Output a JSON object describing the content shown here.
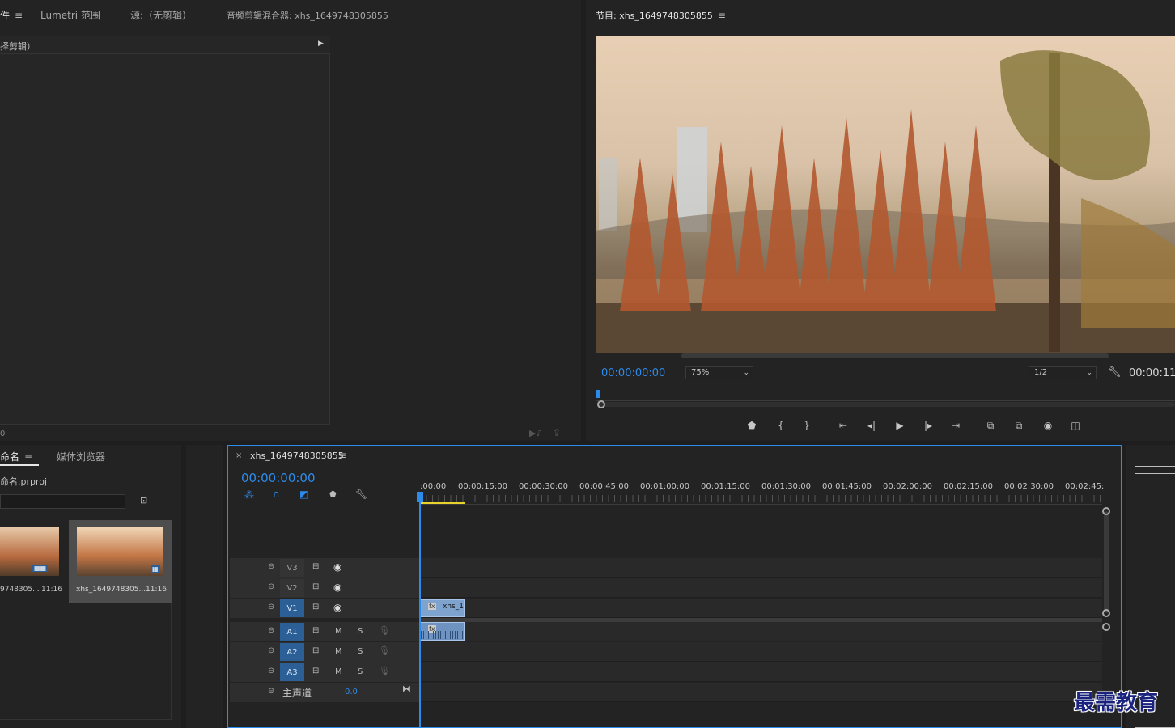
{
  "top_left_panel": {
    "tabs": [
      {
        "label": "件"
      },
      {
        "label": "Lumetri 范围"
      },
      {
        "label": "源:（无剪辑）"
      },
      {
        "label": "音频剪辑混合器: xhs_1649748305855"
      }
    ],
    "effect_controls_header": "择剪辑）",
    "footer_time": "0"
  },
  "program_monitor": {
    "title": "节目: xhs_1649748305855",
    "current_time": "00:00:00:00",
    "zoom": "75%",
    "resolution": "1/2",
    "duration": "00:00:11",
    "controls": [
      {
        "name": "add-marker-icon",
        "glyph": "⬟"
      },
      {
        "name": "mark-in-icon",
        "glyph": "{"
      },
      {
        "name": "mark-out-icon",
        "glyph": "}"
      },
      {
        "name": "go-to-in-icon",
        "glyph": "⇤"
      },
      {
        "name": "step-back-icon",
        "glyph": "◂|"
      },
      {
        "name": "play-icon",
        "glyph": "▶"
      },
      {
        "name": "step-forward-icon",
        "glyph": "|▸"
      },
      {
        "name": "go-to-out-icon",
        "glyph": "⇥"
      },
      {
        "name": "lift-icon",
        "glyph": "⧉"
      },
      {
        "name": "extract-icon",
        "glyph": "⧉"
      },
      {
        "name": "export-frame-icon",
        "glyph": "◉"
      },
      {
        "name": "compare-view-icon",
        "glyph": "◫"
      }
    ]
  },
  "project_panel": {
    "tabs": [
      {
        "label": "命名"
      },
      {
        "label": "媒体浏览器"
      }
    ],
    "project_file": "命名.prproj",
    "items": [
      {
        "name": "9748305...",
        "duration": "11:16"
      },
      {
        "name": "xhs_1649748305...",
        "duration": "11:16"
      }
    ]
  },
  "tools": [
    "selection-tool",
    "track-select-tool",
    "ripple-edit-tool",
    "razor-tool",
    "slip-tool",
    "pen-tool",
    "hand-tool",
    "type-tool"
  ],
  "timeline": {
    "sequence_name": "xhs_1649748305855",
    "current_time": "00:00:00:00",
    "ruler_labels": [
      ":00:00",
      "00:00:15:00",
      "00:00:30:00",
      "00:00:45:00",
      "00:01:00:00",
      "00:01:15:00",
      "00:01:30:00",
      "00:01:45:00",
      "00:02:00:00",
      "00:02:15:00",
      "00:02:30:00",
      "00:02:45:"
    ],
    "video_tracks": [
      "V3",
      "V2",
      "V1"
    ],
    "audio_tracks": [
      "A1",
      "A2",
      "A3"
    ],
    "mute_label": "M",
    "solo_label": "S",
    "master_label": "主声道",
    "master_value": "0.0",
    "clip_label": "xhs_1"
  },
  "watermark": "最需教育",
  "colors": {
    "accent": "#2d8ceb",
    "panel_bg": "#232323",
    "clip_video": "#7fa3cf",
    "clip_audio": "#6f93c0"
  }
}
